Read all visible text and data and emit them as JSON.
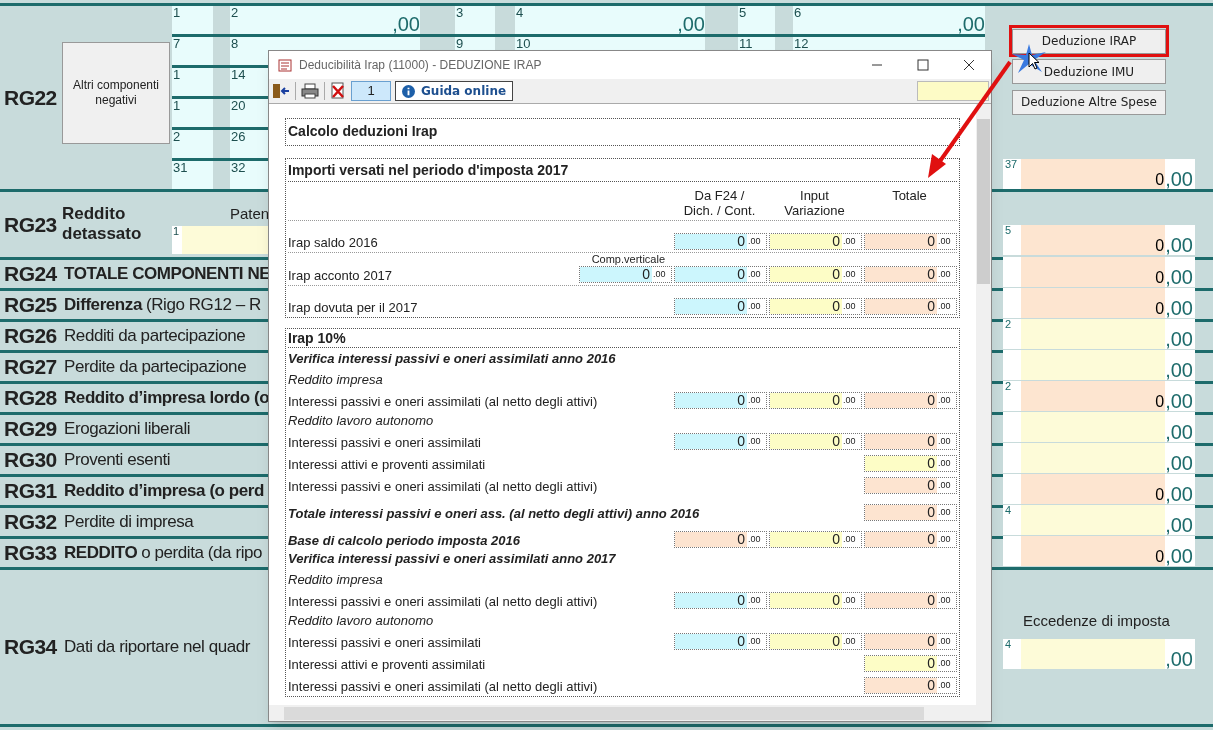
{
  "form": {
    "rg22": {
      "code": "RG22",
      "button": "Altri componenti negativi",
      "grid": [
        [
          {
            "number": "1"
          },
          {
            "number": "2",
            "decimals": ",00"
          },
          {
            "number": "3"
          },
          {
            "number": "4",
            "decimals": ",00"
          },
          {
            "number": "5"
          },
          {
            "number": "6",
            "decimals": ",00"
          }
        ],
        [
          {
            "number": "7"
          },
          {
            "number": "8"
          },
          {
            "number": "9"
          },
          {
            "number": "10"
          },
          {
            "number": "11"
          },
          {
            "number": "12"
          }
        ],
        [
          {
            "number": "1"
          },
          {
            "number": "14"
          }
        ],
        [
          {
            "number": "1"
          },
          {
            "number": "20"
          }
        ],
        [
          {
            "number": "2"
          },
          {
            "number": "26"
          }
        ],
        [
          {
            "number": "31"
          },
          {
            "number": "32"
          }
        ]
      ],
      "side_buttons": [
        {
          "label": "Deduzione IRAP",
          "highlighted": true
        },
        {
          "label": "Deduzione IMU",
          "highlighted": false
        },
        {
          "label": "Deduzione Altre Spese",
          "highlighted": false
        }
      ],
      "field": {
        "number": "37",
        "color": "#fde5d0",
        "amount": "0",
        "decimals": ",00"
      }
    },
    "rg23": {
      "code": "RG23",
      "title": "Reddito detassato",
      "column_label": "Paten",
      "input_number": "1",
      "field": {
        "number": "5",
        "color": "#fde5d0",
        "amount": "0",
        "decimals": ",00"
      }
    },
    "rows": [
      {
        "code": "RG24",
        "parts": [
          {
            "text": "TOTALE COMPONENTI NE",
            "bold": true
          }
        ],
        "field": {
          "color": "#fde5d0",
          "amount": "0",
          "decimals": ",00"
        }
      },
      {
        "code": "RG25",
        "parts": [
          {
            "text": "Differenza",
            "bold": true
          },
          {
            "text": "(Rigo RG12 –  R",
            "bold": false
          }
        ],
        "field": {
          "color": "#fde5d0",
          "amount": "0",
          "decimals": ",00"
        }
      },
      {
        "code": "RG26",
        "parts": [
          {
            "text": "Redditi da partecipazione",
            "bold": false
          }
        ],
        "field": {
          "number": "2",
          "color": "#fdfbd8",
          "decimals": ",00"
        }
      },
      {
        "code": "RG27",
        "parts": [
          {
            "text": "Perdite da partecipazione",
            "bold": false
          }
        ],
        "field": {
          "color": "#fdfbd8",
          "decimals": ",00"
        }
      },
      {
        "code": "RG28",
        "parts": [
          {
            "text": "Reddito d’impresa lordo (o",
            "bold": true
          }
        ],
        "field": {
          "number": "2",
          "color": "#fde5d0",
          "amount": "0",
          "decimals": ",00"
        }
      },
      {
        "code": "RG29",
        "parts": [
          {
            "text": "Erogazioni liberali",
            "bold": false
          }
        ],
        "field": {
          "color": "#fdfbd8",
          "decimals": ",00"
        }
      },
      {
        "code": "RG30",
        "parts": [
          {
            "text": "Proventi esenti",
            "bold": false
          }
        ],
        "field": {
          "color": "#fdfbd8",
          "decimals": ",00"
        }
      },
      {
        "code": "RG31",
        "parts": [
          {
            "text": "Reddito d’impresa (o perd",
            "bold": true
          }
        ],
        "field": {
          "color": "#fde5d0",
          "amount": "0",
          "decimals": ",00"
        }
      },
      {
        "code": "RG32",
        "parts": [
          {
            "text": "Perdite di impresa",
            "bold": false
          }
        ],
        "field": {
          "number": "4",
          "color": "#fdfbd8",
          "decimals": ",00"
        }
      },
      {
        "code": "RG33",
        "parts": [
          {
            "text": "REDDITO",
            "bold": true
          },
          {
            "text": "o perdita (da ripo",
            "bold": false
          }
        ],
        "field": {
          "color": "#fde5d0",
          "amount": "0",
          "decimals": ",00"
        }
      }
    ],
    "rg34": {
      "code": "RG34",
      "text": "Dati da riportare nel quadr",
      "field_label": "Eccedenze di imposta",
      "field": {
        "number": "4",
        "color": "#fdfbd8",
        "decimals": ",00"
      }
    }
  },
  "dialog": {
    "title": "Deducibilità Irap (11000) - DEDUZIONE IRAP",
    "page": "1",
    "help_button": "Guida online",
    "sections": [
      {
        "title": "Calcolo deduzioni Irap"
      },
      {
        "title": "Importi versati nel periodo d'imposta 2017",
        "columns": [
          {
            "label": "Da F24 / Dich. / Cont."
          },
          {
            "label": "Input Variazione"
          },
          {
            "label": "Totale"
          }
        ],
        "items": [
          {
            "kind": "row",
            "label": "Irap saldo 2016",
            "fields": [
              {
                "color": "#ccf6fd",
                "value": "0",
                "decimals": ".00"
              },
              {
                "color": "#fdfdc6",
                "value": "0",
                "decimals": ".00"
              },
              {
                "color": "#fde4d0",
                "value": "0",
                "decimals": ".00"
              }
            ]
          },
          {
            "kind": "row",
            "label": "Irap acconto 2017",
            "extra_label": "Comp.verticale",
            "fields": [
              {
                "color": "#ccf6fd",
                "value": "0",
                "decimals": ".00"
              },
              {
                "color": "#ccf6fd",
                "value": "0",
                "decimals": ".00"
              },
              {
                "color": "#fdfdc6",
                "value": "0",
                "decimals": ".00"
              },
              {
                "color": "#fde4d0",
                "value": "0",
                "decimals": ".00"
              }
            ]
          },
          {
            "kind": "row",
            "label": "Irap dovuta per il 2017",
            "fields": [
              {
                "color": "#ccf6fd",
                "value": "0",
                "decimals": ".00"
              },
              {
                "color": "#fdfdc6",
                "value": "0",
                "decimals": ".00"
              },
              {
                "color": "#fde4d0",
                "value": "0",
                "decimals": ".00"
              }
            ]
          }
        ]
      },
      {
        "title": "Irap 10%",
        "items": [
          {
            "kind": "subheading",
            "label": "Verifica interessi passivi e oneri assimilati anno 2016"
          },
          {
            "kind": "group",
            "label": "Reddito impresa"
          },
          {
            "kind": "row",
            "label": "Interessi passivi e oneri assimilati (al netto degli attivi)",
            "fields": [
              {
                "color": "#ccf6fd",
                "value": "0",
                "decimals": ".00"
              },
              {
                "color": "#fdfdc6",
                "value": "0",
                "decimals": ".00"
              },
              {
                "color": "#fde4d0",
                "value": "0",
                "decimals": ".00"
              }
            ]
          },
          {
            "kind": "group",
            "label": "Reddito lavoro autonomo"
          },
          {
            "kind": "row",
            "label": "Interessi passivi e oneri assimilati",
            "fields": [
              {
                "color": "#ccf6fd",
                "value": "0",
                "decimals": ".00"
              },
              {
                "color": "#fdfdc6",
                "value": "0",
                "decimals": ".00"
              },
              {
                "color": "#fde4d0",
                "value": "0",
                "decimals": ".00"
              }
            ]
          },
          {
            "kind": "row",
            "label": "Interessi attivi e proventi assimilati",
            "fields": [
              {
                "color": "#fdfdc6",
                "value": "0",
                "decimals": ".00"
              }
            ]
          },
          {
            "kind": "row",
            "label": "Interessi passivi e oneri assimilati (al netto degli attivi)",
            "fields": [
              {
                "color": "#fde4d0",
                "value": "0",
                "decimals": ".00"
              }
            ]
          },
          {
            "kind": "total",
            "label": "Totale interessi passivi e oneri ass. (al netto degli attivi) anno 2016",
            "fields": [
              {
                "color": "#fde4d0",
                "value": "0",
                "decimals": ".00"
              }
            ]
          },
          {
            "kind": "total",
            "label": "Base di calcolo periodo imposta 2016",
            "fields": [
              {
                "color": "#fde4d0",
                "value": "0",
                "decimals": ".00"
              },
              {
                "color": "#fdfdc6",
                "value": "0",
                "decimals": ".00"
              },
              {
                "color": "#fde4d0",
                "value": "0",
                "decimals": ".00"
              }
            ]
          },
          {
            "kind": "subheading",
            "label": "Verifica interessi passivi e oneri assimilati anno 2017"
          },
          {
            "kind": "group",
            "label": "Reddito impresa"
          },
          {
            "kind": "row",
            "label": "Interessi passivi e oneri assimilati (al netto degli attivi)",
            "fields": [
              {
                "color": "#ccf6fd",
                "value": "0",
                "decimals": ".00"
              },
              {
                "color": "#fdfdc6",
                "value": "0",
                "decimals": ".00"
              },
              {
                "color": "#fde4d0",
                "value": "0",
                "decimals": ".00"
              }
            ]
          },
          {
            "kind": "group",
            "label": "Reddito lavoro autonomo"
          },
          {
            "kind": "row",
            "label": "Interessi passivi e oneri assimilati",
            "fields": [
              {
                "color": "#ccf6fd",
                "value": "0",
                "decimals": ".00"
              },
              {
                "color": "#fdfdc6",
                "value": "0",
                "decimals": ".00"
              },
              {
                "color": "#fde4d0",
                "value": "0",
                "decimals": ".00"
              }
            ]
          },
          {
            "kind": "row",
            "label": "Interessi attivi e proventi assimilati",
            "fields": [
              {
                "color": "#fdfdc6",
                "value": "0",
                "decimals": ".00"
              }
            ]
          },
          {
            "kind": "row",
            "label": "Interessi passivi e oneri assimilati (al netto degli attivi)",
            "fields": [
              {
                "color": "#fde4d0",
                "value": "0",
                "decimals": ".00"
              }
            ]
          }
        ]
      }
    ]
  }
}
